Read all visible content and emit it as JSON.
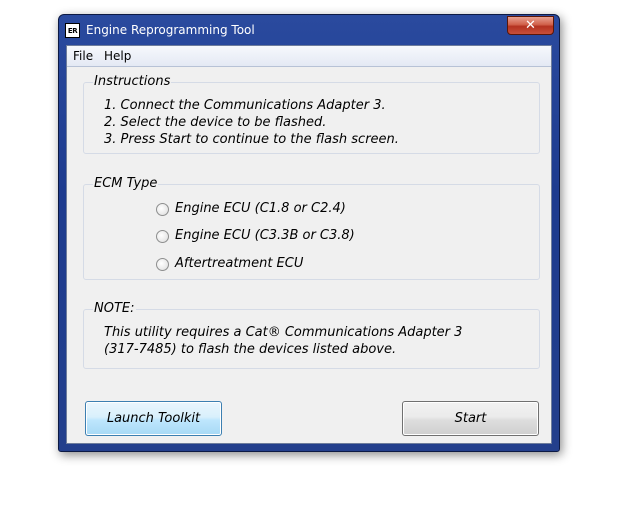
{
  "window": {
    "title": "Engine Reprogramming Tool",
    "icon_text": "ER",
    "close_symbol": "✕"
  },
  "menu": {
    "items": [
      "File",
      "Help"
    ]
  },
  "instructions": {
    "title": "Instructions",
    "lines": [
      "1. Connect the Communications Adapter 3.",
      "2. Select the device to be flashed.",
      "3. Press Start to continue to the flash screen."
    ]
  },
  "ecm_type": {
    "title": "ECM Type",
    "options": [
      {
        "label": "Engine ECU (C1.8 or C2.4)",
        "selected": false
      },
      {
        "label": "Engine ECU (C3.3B or C3.8)",
        "selected": false
      },
      {
        "label": "Aftertreatment ECU",
        "selected": false
      }
    ]
  },
  "note": {
    "title": "NOTE:",
    "lines": [
      "This utility requires a Cat® Communications Adapter 3",
      "(317-7485) to flash the devices listed above."
    ]
  },
  "buttons": {
    "launch_toolkit": "Launch Toolkit",
    "start": "Start"
  },
  "colors": {
    "title_bar": "#1d3b8f",
    "close_button": "#c8503a",
    "launch_button_border": "#3c7fb1",
    "dialog_background": "#f0f0f0"
  }
}
